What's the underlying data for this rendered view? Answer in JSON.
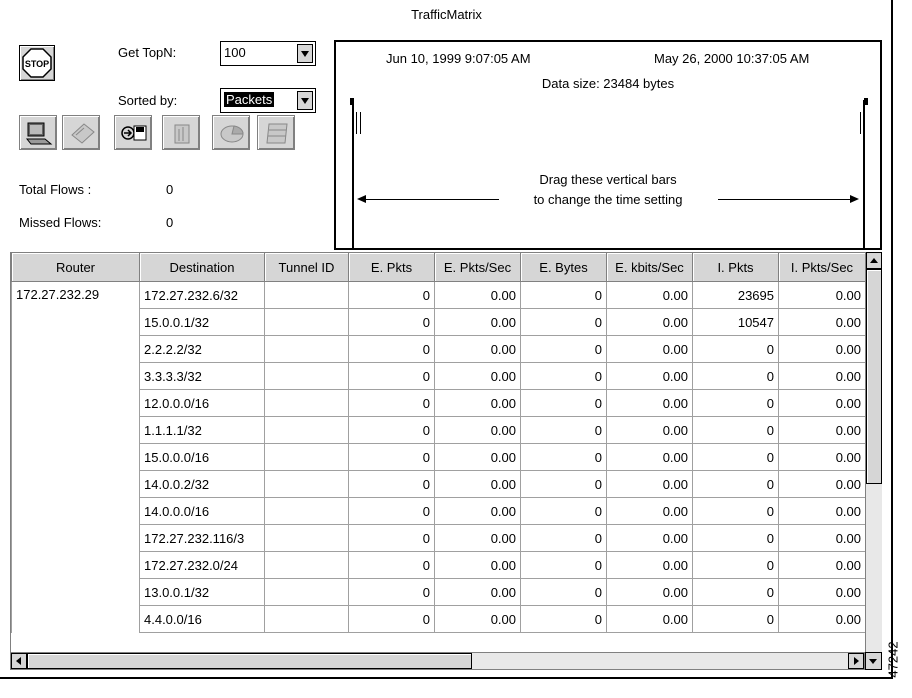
{
  "window": {
    "title": "TrafficMatrix"
  },
  "controls": {
    "stop_label": "STOP",
    "topn_label": "Get TopN:",
    "topn_value": "100",
    "sorted_label": "Sorted by:",
    "sorted_value": "Packets",
    "total_flows_label": "Total Flows :",
    "total_flows_value": "0",
    "missed_flows_label": "Missed Flows:",
    "missed_flows_value": "0"
  },
  "toolbar": [
    "computer-icon",
    "disk-icon",
    "save-export-icon",
    "bar-chart-icon",
    "pie-chart-icon",
    "table-icon"
  ],
  "timeline": {
    "start_time": "Jun 10, 1999 9:07:05 AM",
    "end_time": "May 26, 2000 10:37:05 AM",
    "data_size": "Data size: 23484 bytes",
    "hint_line1": "Drag these vertical bars",
    "hint_line2": "to change the time setting"
  },
  "table": {
    "columns": [
      "Router",
      "Destination",
      "Tunnel ID",
      "E. Pkts",
      "E. Pkts/Sec",
      "E. Bytes",
      "E. kbits/Sec",
      "I. Pkts",
      "I. Pkts/Sec"
    ],
    "router": "172.27.232.29",
    "rows": [
      {
        "destination": "172.27.232.6/32",
        "tunnel": "",
        "e_pkts": "0",
        "e_pkts_sec": "0.00",
        "e_bytes": "0",
        "e_kbits": "0.00",
        "i_pkts": "23695",
        "i_pkts_sec": "0.00"
      },
      {
        "destination": "15.0.0.1/32",
        "tunnel": "",
        "e_pkts": "0",
        "e_pkts_sec": "0.00",
        "e_bytes": "0",
        "e_kbits": "0.00",
        "i_pkts": "10547",
        "i_pkts_sec": "0.00"
      },
      {
        "destination": "2.2.2.2/32",
        "tunnel": "",
        "e_pkts": "0",
        "e_pkts_sec": "0.00",
        "e_bytes": "0",
        "e_kbits": "0.00",
        "i_pkts": "0",
        "i_pkts_sec": "0.00"
      },
      {
        "destination": "3.3.3.3/32",
        "tunnel": "",
        "e_pkts": "0",
        "e_pkts_sec": "0.00",
        "e_bytes": "0",
        "e_kbits": "0.00",
        "i_pkts": "0",
        "i_pkts_sec": "0.00"
      },
      {
        "destination": "12.0.0.0/16",
        "tunnel": "",
        "e_pkts": "0",
        "e_pkts_sec": "0.00",
        "e_bytes": "0",
        "e_kbits": "0.00",
        "i_pkts": "0",
        "i_pkts_sec": "0.00"
      },
      {
        "destination": "1.1.1.1/32",
        "tunnel": "",
        "e_pkts": "0",
        "e_pkts_sec": "0.00",
        "e_bytes": "0",
        "e_kbits": "0.00",
        "i_pkts": "0",
        "i_pkts_sec": "0.00"
      },
      {
        "destination": "15.0.0.0/16",
        "tunnel": "",
        "e_pkts": "0",
        "e_pkts_sec": "0.00",
        "e_bytes": "0",
        "e_kbits": "0.00",
        "i_pkts": "0",
        "i_pkts_sec": "0.00"
      },
      {
        "destination": "14.0.0.2/32",
        "tunnel": "",
        "e_pkts": "0",
        "e_pkts_sec": "0.00",
        "e_bytes": "0",
        "e_kbits": "0.00",
        "i_pkts": "0",
        "i_pkts_sec": "0.00"
      },
      {
        "destination": "14.0.0.0/16",
        "tunnel": "",
        "e_pkts": "0",
        "e_pkts_sec": "0.00",
        "e_bytes": "0",
        "e_kbits": "0.00",
        "i_pkts": "0",
        "i_pkts_sec": "0.00"
      },
      {
        "destination": "172.27.232.116/3",
        "tunnel": "",
        "e_pkts": "0",
        "e_pkts_sec": "0.00",
        "e_bytes": "0",
        "e_kbits": "0.00",
        "i_pkts": "0",
        "i_pkts_sec": "0.00"
      },
      {
        "destination": "172.27.232.0/24",
        "tunnel": "",
        "e_pkts": "0",
        "e_pkts_sec": "0.00",
        "e_bytes": "0",
        "e_kbits": "0.00",
        "i_pkts": "0",
        "i_pkts_sec": "0.00"
      },
      {
        "destination": "13.0.0.1/32",
        "tunnel": "",
        "e_pkts": "0",
        "e_pkts_sec": "0.00",
        "e_bytes": "0",
        "e_kbits": "0.00",
        "i_pkts": "0",
        "i_pkts_sec": "0.00"
      },
      {
        "destination": "4.4.0.0/16",
        "tunnel": "",
        "e_pkts": "0",
        "e_pkts_sec": "0.00",
        "e_bytes": "0",
        "e_kbits": "0.00",
        "i_pkts": "0",
        "i_pkts_sec": "0.00"
      }
    ]
  },
  "figure_number": "47242"
}
